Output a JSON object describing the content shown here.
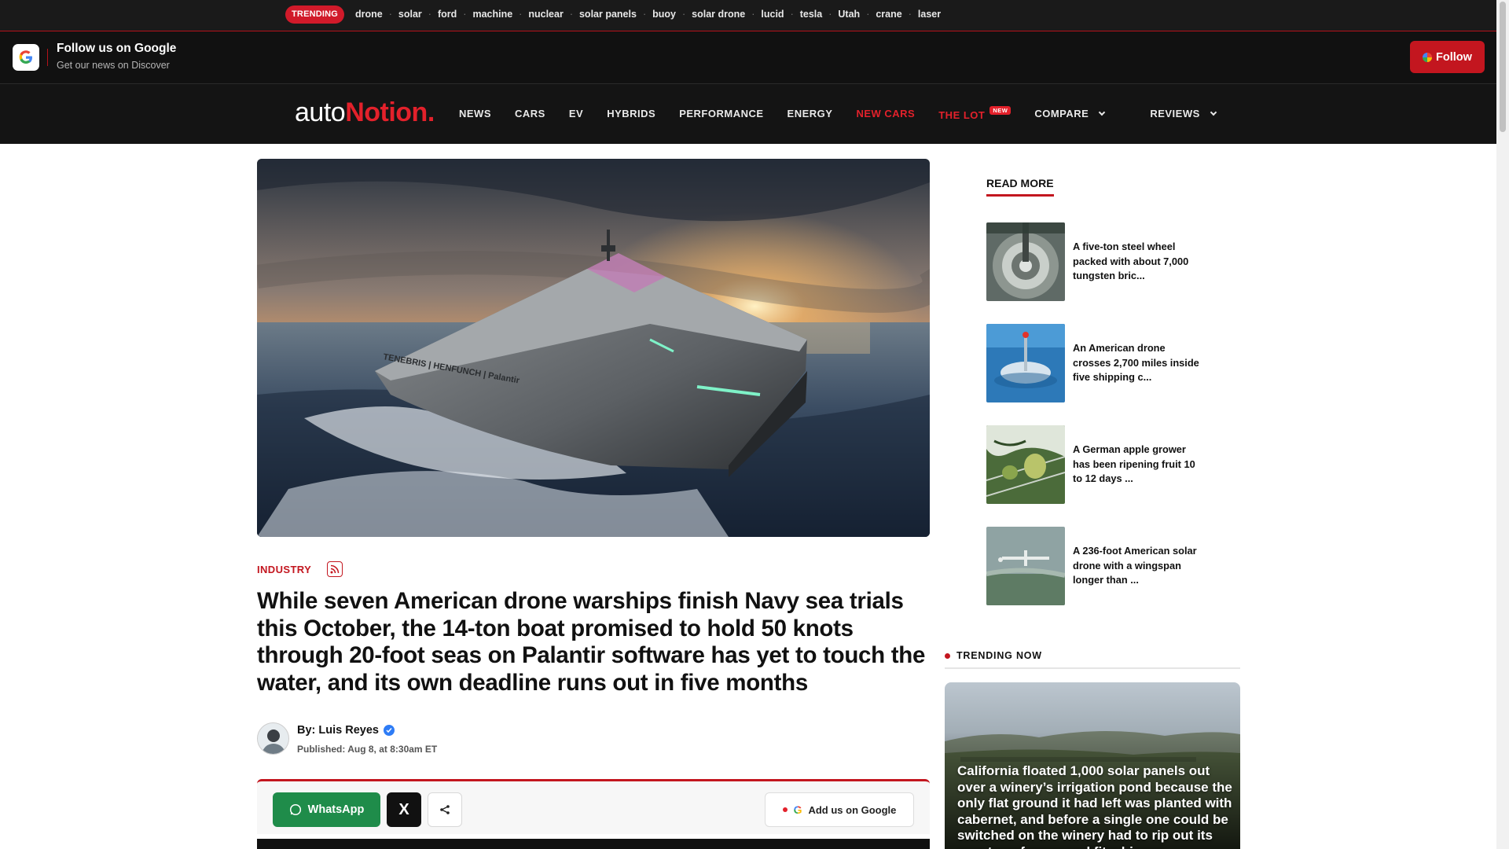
{
  "trending": {
    "badge": "TRENDING",
    "tags": [
      "drone",
      "solar",
      "ford",
      "machine",
      "nuclear",
      "solar panels",
      "buoy",
      "solar drone",
      "lucid",
      "tesla",
      "Utah",
      "crane",
      "laser"
    ]
  },
  "follow_bar": {
    "title": "Follow us on Google",
    "subtitle": "Get our news on Discover",
    "button": "Follow"
  },
  "nav": {
    "logo_left": "auto",
    "logo_n": "N",
    "logo_right": "otion",
    "logo_dot": ".",
    "items": [
      "NEWS",
      "CARS",
      "EV",
      "HYBRIDS",
      "PERFORMANCE",
      "ENERGY",
      "NEW CARS",
      "THE LOT",
      "COMPARE",
      "REVIEWS"
    ],
    "new_tag": "NEW"
  },
  "article": {
    "category": "INDUSTRY",
    "headline": "While seven American drone warships finish Navy sea trials this October, the 14-ton boat promised to hold 50 knots through 20-foot seas on Palantir software has yet to touch the water, and its own deadline runs out in five months",
    "hull_text": "TENEBRIS | HENFUNCH | Palantir",
    "author": "By: Luis Reyes",
    "published": "Published: Aug 8, at 8:30am ET"
  },
  "share": {
    "whatsapp": "WhatsApp",
    "x": "X",
    "add_google": "Add us on Google",
    "g": "G"
  },
  "sidebar": {
    "read_more_title": "READ MORE",
    "read_more": [
      {
        "text": "A five-ton steel wheel packed with about 7,000 tungsten bric..."
      },
      {
        "text": "An American drone crosses 2,700 miles inside five shipping c..."
      },
      {
        "text": "A German apple grower has been ripening fruit 10 to 12 days ..."
      },
      {
        "text": "A 236-foot American solar drone with a wingspan longer than ..."
      }
    ],
    "trending_now_title": "TRENDING NOW",
    "trending_card": "California floated 1,000 solar panels out over a winery’s irrigation pond because the only flat ground it had left was planted with cabernet, and before a single one could be switched on the winery had to rip out its own transformer and fit a bigger"
  },
  "colors": {
    "accent": "#c3161f",
    "nav_bg": "#141414",
    "whatsapp": "#1f8c4a"
  }
}
